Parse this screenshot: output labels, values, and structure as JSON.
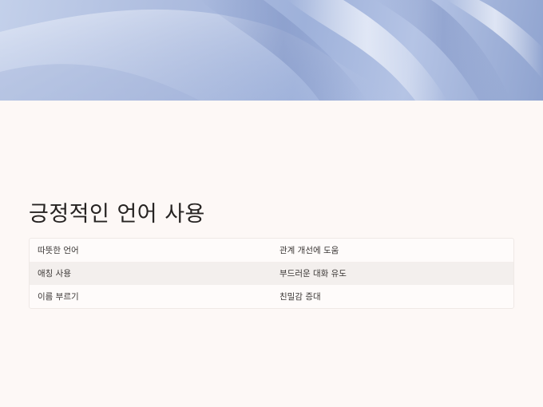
{
  "slide": {
    "title": "긍정적인 언어 사용",
    "rows": [
      {
        "left": "따뜻한 언어",
        "right": "관계 개선에 도움"
      },
      {
        "left": "애칭 사용",
        "right": "부드러운 대화 유도"
      },
      {
        "left": "이름 부르기",
        "right": "친밀감 증대"
      }
    ]
  },
  "banner": {
    "image": "blue-silk-fabric",
    "colors": {
      "light": "#c3d0ea",
      "mid": "#9eb1da",
      "dark": "#8fa3cf"
    }
  },
  "colors": {
    "background": "#fdf8f6",
    "row_alt": "#f3efed",
    "text": "#262322"
  }
}
